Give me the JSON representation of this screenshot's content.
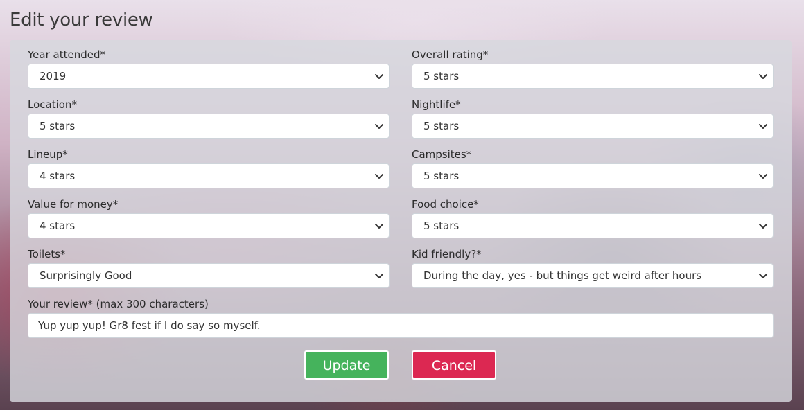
{
  "page": {
    "title": "Edit your review"
  },
  "form": {
    "year_attended": {
      "label": "Year attended*",
      "value": "2019"
    },
    "overall_rating": {
      "label": "Overall rating*",
      "value": "5 stars"
    },
    "location": {
      "label": "Location*",
      "value": "5 stars"
    },
    "nightlife": {
      "label": "Nightlife*",
      "value": "5 stars"
    },
    "lineup": {
      "label": "Lineup*",
      "value": "4 stars"
    },
    "campsites": {
      "label": "Campsites*",
      "value": "5 stars"
    },
    "value_for_money": {
      "label": "Value for money*",
      "value": "4 stars"
    },
    "food_choice": {
      "label": "Food choice*",
      "value": "5 stars"
    },
    "toilets": {
      "label": "Toilets*",
      "value": "Surprisingly Good"
    },
    "kid_friendly": {
      "label": "Kid friendly?*",
      "value": "During the day, yes - but things get weird after hours"
    },
    "review": {
      "label": "Your review* (max 300 characters)",
      "value": "Yup yup yup! Gr8 fest if I do say so myself."
    }
  },
  "buttons": {
    "update_label": "Update",
    "cancel_label": "Cancel"
  },
  "colors": {
    "update": "#45b35c",
    "cancel": "#dc2852",
    "panel": "#d7d8de"
  },
  "icons": {
    "select_arrow": "chevron-down-icon"
  }
}
